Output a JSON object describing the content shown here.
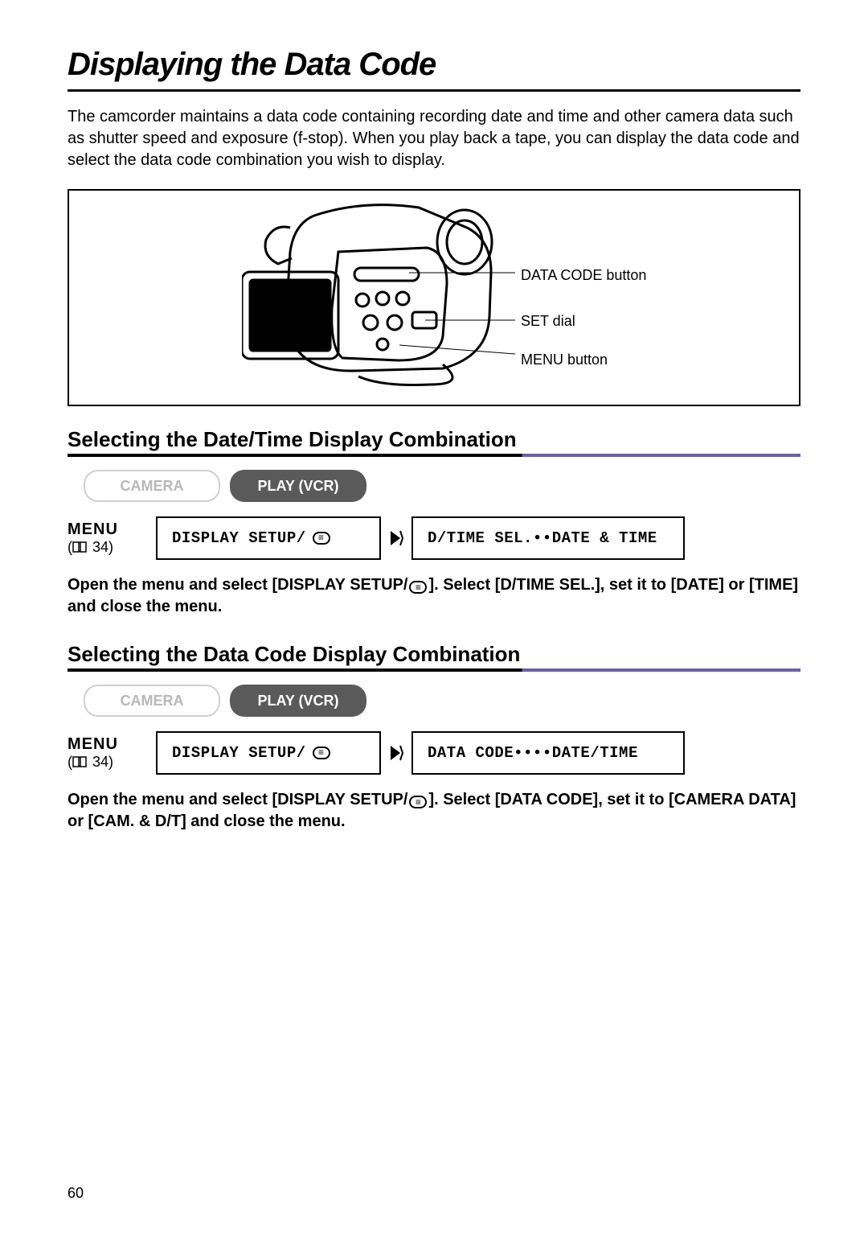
{
  "page_title": "Displaying the Data Code",
  "intro": "The camcorder maintains a data code containing recording date and time and other camera data such as shutter speed and exposure (f-stop). When you play back a tape, you can display the data code and select the data code combination you wish to display.",
  "diagram": {
    "callouts": {
      "data_code": "DATA CODE button",
      "set_dial": "SET dial",
      "menu_button": "MENU button"
    }
  },
  "sections": [
    {
      "heading": "Selecting the Date/Time Display Combination",
      "modes": {
        "inactive": "CAMERA",
        "active": "PLAY (VCR)"
      },
      "menu": {
        "label": "MENU",
        "page_ref": "34",
        "box1": "DISPLAY SETUP/",
        "box2": "D/TIME SEL.••DATE & TIME"
      },
      "instruction_pre": "Open the menu and select [DISPLAY SETUP/",
      "instruction_post": "]. Select [D/TIME SEL.], set it to [DATE] or [TIME] and close the menu."
    },
    {
      "heading": "Selecting the Data Code Display Combination",
      "modes": {
        "inactive": "CAMERA",
        "active": "PLAY (VCR)"
      },
      "menu": {
        "label": "MENU",
        "page_ref": "34",
        "box1": "DISPLAY SETUP/",
        "box2": "DATA CODE••••DATE/TIME"
      },
      "instruction_pre": "Open the menu and select [DISPLAY SETUP/",
      "instruction_post": "]. Select [DATA CODE], set it to [CAMERA DATA] or [CAM. & D/T] and close the menu."
    }
  ],
  "page_number": "60"
}
